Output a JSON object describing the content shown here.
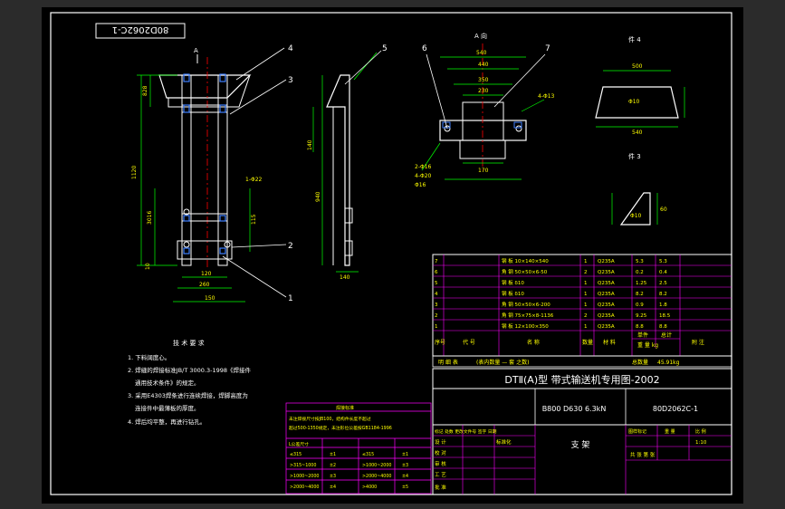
{
  "drawing_number_mirrored": "80D2062C-1",
  "balloons": [
    "1",
    "2",
    "3",
    "4",
    "5",
    "6",
    "7"
  ],
  "view_labels": {
    "top_a": "A",
    "view_a": "A 向",
    "part4": "件 4",
    "part3": "件 3"
  },
  "main_view_dims": [
    "828",
    "120",
    "260",
    "150",
    "1120",
    "3016",
    "115",
    "10",
    "10"
  ],
  "side_view_dims": [
    "140",
    "940",
    "1-Φ22",
    "140"
  ],
  "a_view_dims": [
    "540",
    "440",
    "350",
    "230",
    "170",
    "4-Φ13",
    "2-Φ16",
    "4-Φ20",
    "Φ16"
  ],
  "part4_dims": [
    "500",
    "Φ10",
    "540"
  ],
  "part3_dims": [
    "Φ10",
    "60"
  ],
  "tech_requirements": {
    "title": "技 术 要 求",
    "items": [
      "1. 下料阔度心。",
      "2. 焊缝的焊接标准JB/T 3000.3-1998《焊接件",
      "通用技术条件》的规定。",
      "3. 采用E4303焊条进行连续焊接，焊脚高度为",
      "连接件中最薄板的厚度。",
      "4. 焊后均平整，再进行钻孔。"
    ]
  },
  "parts_list": {
    "rows": [
      {
        "no": "7",
        "code": "",
        "name": "钢 板 10×140×540",
        "qty": "1",
        "material": "Q235A",
        "unit": "5.3",
        "total": "5.3"
      },
      {
        "no": "6",
        "code": "",
        "name": "角 钢 50×50×6-50",
        "qty": "2",
        "material": "Q235A",
        "unit": "0.2",
        "total": "0.4"
      },
      {
        "no": "5",
        "code": "",
        "name": "钢 板 δ10",
        "qty": "1",
        "material": "Q235A",
        "unit": "1.25",
        "total": "2.5"
      },
      {
        "no": "4",
        "code": "",
        "name": "钢 板 δ10",
        "qty": "1",
        "material": "Q235A",
        "unit": "8.2",
        "total": "8.2"
      },
      {
        "no": "3",
        "code": "",
        "name": "角 钢 50×50×6-200",
        "qty": "1",
        "material": "Q235A",
        "unit": "0.9",
        "total": "1.8"
      },
      {
        "no": "2",
        "code": "",
        "name": "角 钢 75×75×8-1136",
        "qty": "2",
        "material": "Q235A",
        "unit": "9.25",
        "total": "18.5"
      },
      {
        "no": "1",
        "code": "",
        "name": "钢 板 12×100×350",
        "qty": "1",
        "material": "Q235A",
        "unit": "8.8",
        "total": "8.8"
      }
    ],
    "header": {
      "no": "序号",
      "code": "代 号",
      "name": "名 称",
      "qty": "数量",
      "material": "材 料",
      "unit_w": "单件",
      "total_w": "总计",
      "weight_unit": "重 量 kg",
      "remark": "附 注"
    },
    "detail_row": {
      "label": "明  细  表",
      "note": "(表内数量 — 套 之数)",
      "total_label": "总数量",
      "total_weight": "45.91kg"
    }
  },
  "title_block": {
    "project": "DTⅡ(A)型 带式输送机专用图-2002",
    "model": "B800 D630 6.3kN",
    "drawing_no": "80D2062C-1",
    "part_name": "支 架",
    "stage_label": "图样标记",
    "weight_label": "重 量",
    "scale_label": "比 例",
    "scale": "1:10",
    "sheet": "共   张   第   张",
    "revision_header": "标记 处数 更改文件号 签字 日期",
    "roles": [
      "设 计",
      "校 对",
      "审 核",
      "工 艺",
      "批 准"
    ],
    "standard": "标准化"
  },
  "notes_table": {
    "title": "焊接标准",
    "lines": [
      "未注焊接尺寸按JB100，结构件长度不超过",
      "超过500-1350规定，未注形位公差按GB1184-1996",
      "L公差尺寸"
    ],
    "rows": [
      [
        "≤315",
        "±1",
        "≤315",
        "±1"
      ],
      [
        ">315~1000",
        "±2",
        ">1000~2000",
        "±3"
      ],
      [
        ">1000~2000",
        "±3",
        ">2000~4000",
        "±4"
      ],
      [
        ">2000~4000",
        "±4",
        ">4000",
        "±5"
      ]
    ]
  },
  "colors": {
    "background": "#000000",
    "frame": "#ffffff",
    "yellow": "#ffff00",
    "green": "#00ff00",
    "magenta": "#ff00ff",
    "cyan": "#00ffff",
    "red": "#ff0000",
    "blue": "#4080ff"
  }
}
